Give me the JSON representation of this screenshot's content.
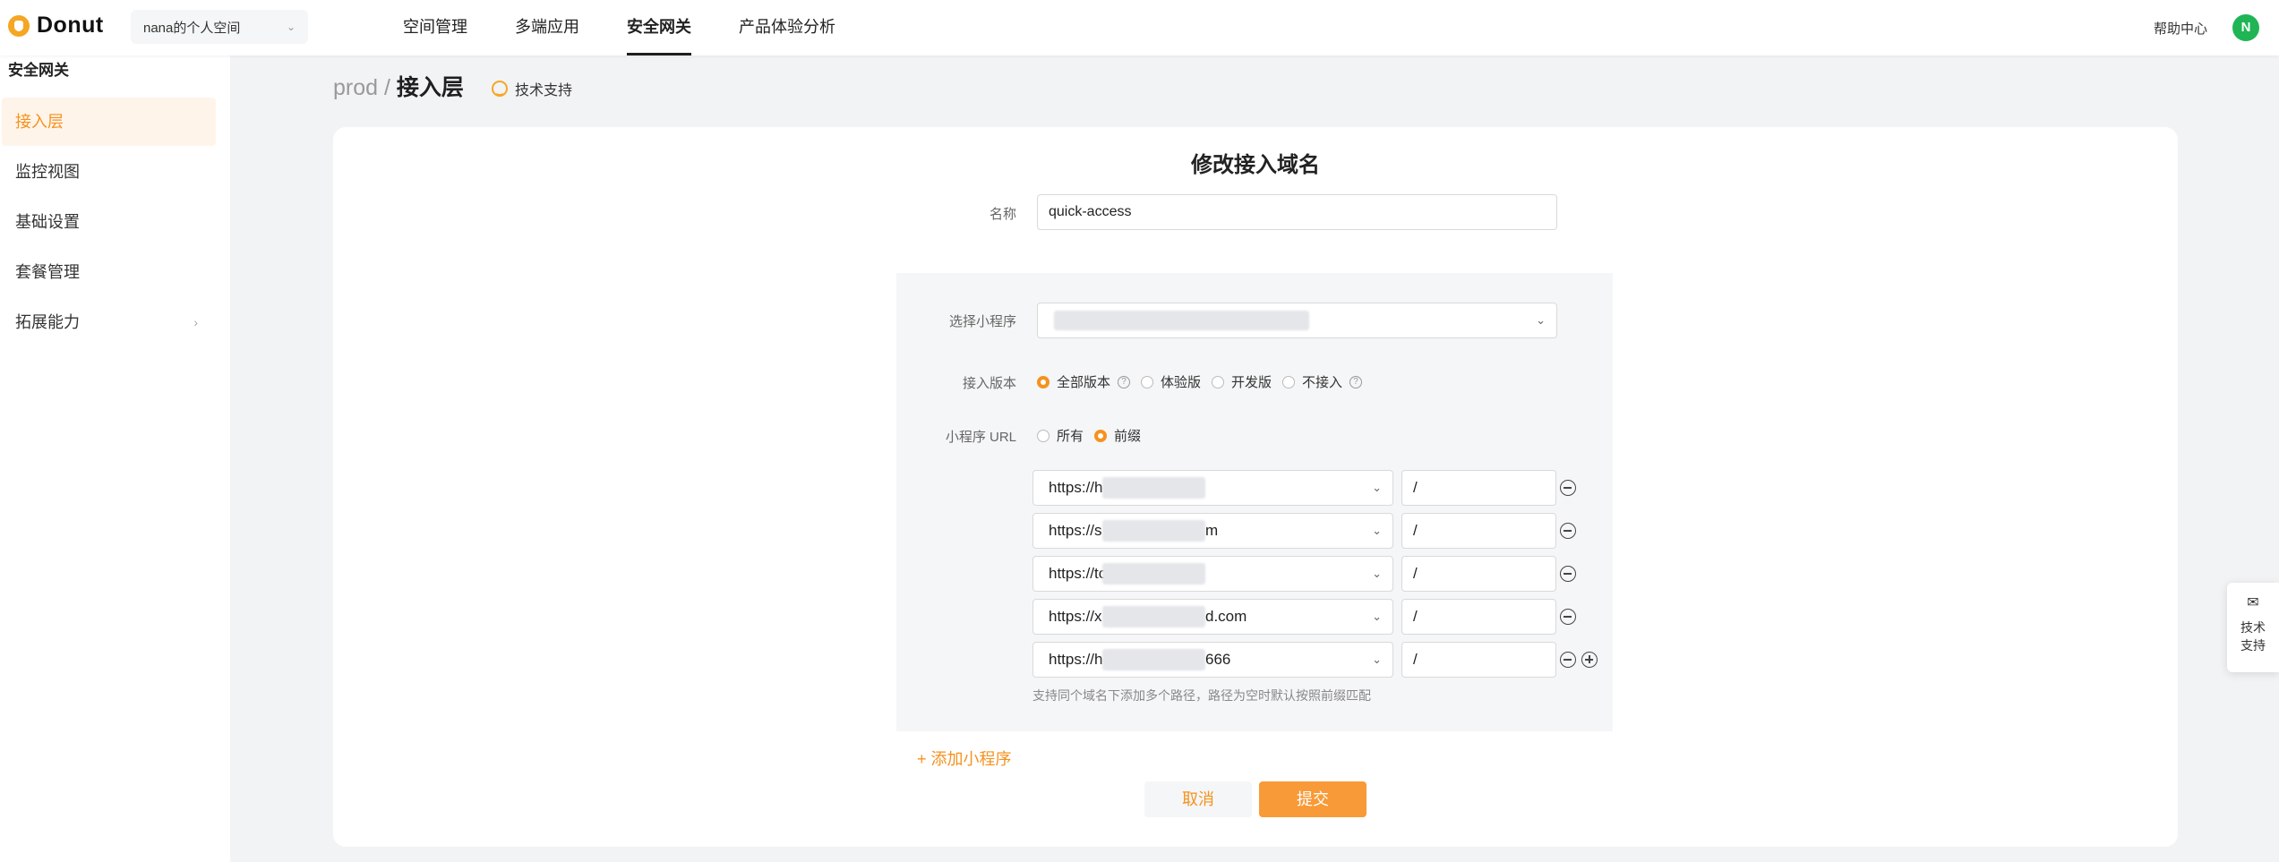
{
  "brand": {
    "name": "Donut"
  },
  "space_selector": {
    "value": "nana的个人空间"
  },
  "nav": [
    {
      "label": "空间管理"
    },
    {
      "label": "多端应用"
    },
    {
      "label": "安全网关",
      "active": true
    },
    {
      "label": "产品体验分析"
    }
  ],
  "header_right": {
    "help": "帮助中心",
    "avatar_letter": "N"
  },
  "sidebar": {
    "title": "安全网关",
    "items": [
      {
        "label": "接入层",
        "active": true
      },
      {
        "label": "监控视图"
      },
      {
        "label": "基础设置"
      },
      {
        "label": "套餐管理"
      },
      {
        "label": "拓展能力",
        "has_arrow": true
      }
    ]
  },
  "breadcrumb": {
    "env": "prod",
    "sep": "/",
    "current": "接入层",
    "support": "技术支持"
  },
  "form": {
    "title": "修改接入域名",
    "name_label": "名称",
    "name_value": "quick-access",
    "miniapp_label": "选择小程序",
    "version_label": "接入版本",
    "versions": [
      {
        "label": "全部版本",
        "checked": true,
        "help": true
      },
      {
        "label": "体验版",
        "checked": false
      },
      {
        "label": "开发版",
        "checked": false
      },
      {
        "label": "不接入",
        "checked": false,
        "help": true
      }
    ],
    "url_label": "小程序 URL",
    "url_modes": [
      {
        "label": "所有",
        "checked": false
      },
      {
        "label": "前缀",
        "checked": true
      }
    ],
    "url_rows": [
      {
        "prefix": "https://h",
        "suffix": "",
        "path": "/"
      },
      {
        "prefix": "https://s",
        "suffix": "m",
        "path": "/"
      },
      {
        "prefix": "https://to",
        "suffix": "",
        "path": "/"
      },
      {
        "prefix": "https://x",
        "suffix": "d.com",
        "path": "/"
      },
      {
        "prefix": "https://h",
        "suffix": "666",
        "path": "/"
      }
    ],
    "hint": "支持同个域名下添加多个路径，路径为空时默认按照前缀匹配",
    "add_miniapp": "+ 添加小程序",
    "cancel": "取消",
    "submit": "提交"
  },
  "float_support": {
    "label_1": "技术",
    "label_2": "支持"
  },
  "colors": {
    "accent": "#f5921e",
    "submit": "#f89a37",
    "avatar": "#1fb555"
  }
}
